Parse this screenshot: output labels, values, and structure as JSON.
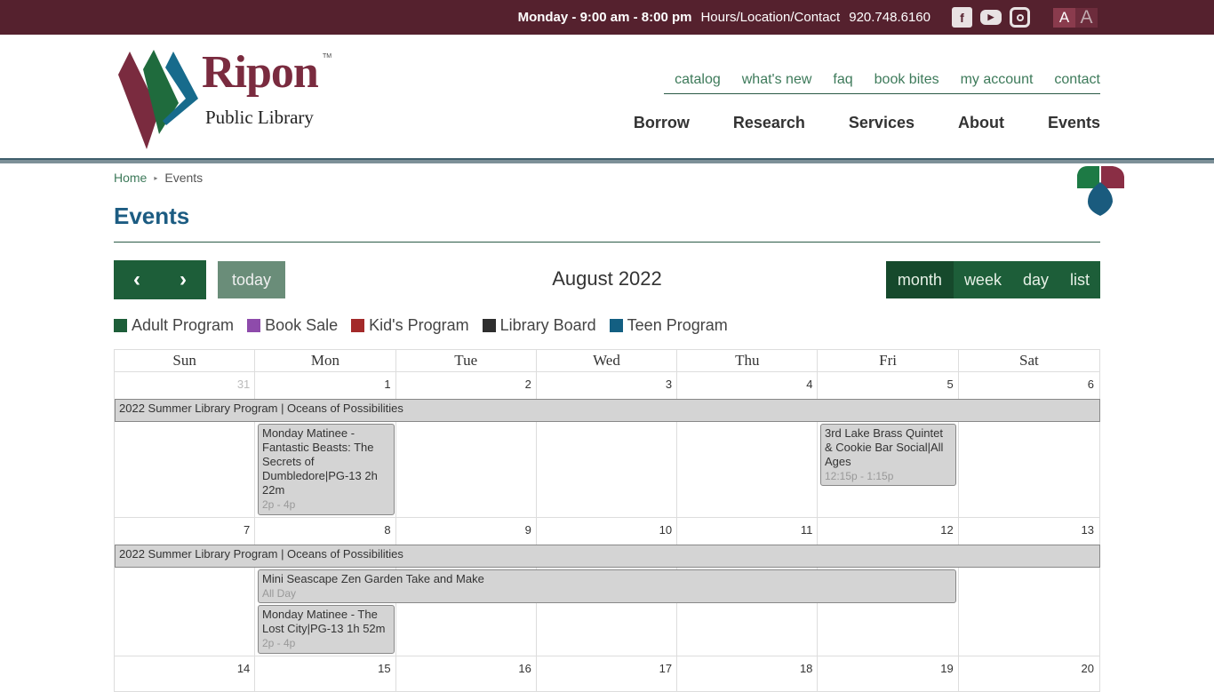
{
  "topbar": {
    "hours": "Monday - 9:00 am - 8:00 pm",
    "hours_link": "Hours/Location/Contact",
    "phone": "920.748.6160",
    "social": [
      "facebook-icon",
      "youtube-icon",
      "instagram-icon"
    ],
    "font_small": "A",
    "font_large": "A"
  },
  "logo": {
    "name": "Ripon",
    "tm": "TM",
    "subtitle": "Public Library"
  },
  "utility_nav": [
    "catalog",
    "what's new",
    "faq",
    "book bites",
    "my account",
    "contact"
  ],
  "main_nav": [
    "Borrow",
    "Research",
    "Services",
    "About",
    "Events"
  ],
  "breadcrumb": {
    "home": "Home",
    "sep": "▸",
    "current": "Events"
  },
  "page_title": "Events",
  "calendar": {
    "prev": "‹",
    "next": "›",
    "today": "today",
    "title": "August 2022",
    "views": [
      "month",
      "week",
      "day",
      "list"
    ],
    "active_view": "month",
    "legend": [
      {
        "label": "Adult Program",
        "color": "#1d5e39"
      },
      {
        "label": "Book Sale",
        "color": "#8e4bab"
      },
      {
        "label": "Kid's Program",
        "color": "#a32a2a"
      },
      {
        "label": "Library Board",
        "color": "#2e2e2e"
      },
      {
        "label": "Teen Program",
        "color": "#135f82"
      }
    ],
    "day_headers": [
      "Sun",
      "Mon",
      "Tue",
      "Wed",
      "Thu",
      "Fri",
      "Sat"
    ],
    "weeks": [
      {
        "days": [
          "31",
          "1",
          "2",
          "3",
          "4",
          "5",
          "6"
        ]
      },
      {
        "days": [
          "7",
          "8",
          "9",
          "10",
          "11",
          "12",
          "13"
        ]
      },
      {
        "days": [
          "14",
          "15",
          "16",
          "17",
          "18",
          "19",
          "20"
        ]
      }
    ],
    "events": {
      "w1_span": "2022 Summer Library Program | Oceans of Possibilities",
      "w1_mon": {
        "title": "Monday Matinee - Fantastic Beasts: The Secrets of Dumbledore|PG-13 2h 22m",
        "time": "2p - 4p"
      },
      "w1_fri": {
        "title": "3rd Lake Brass Quintet & Cookie Bar Social|All Ages",
        "time": "12:15p - 1:15p"
      },
      "w2_span": "2022 Summer Library Program | Oceans of Possibilities",
      "w2_zen": {
        "title": "Mini Seascape Zen Garden Take and Make",
        "time": "All Day"
      },
      "w2_mon": {
        "title": "Monday Matinee - The Lost City|PG-13 1h 52m",
        "time": "2p - 4p"
      }
    }
  }
}
